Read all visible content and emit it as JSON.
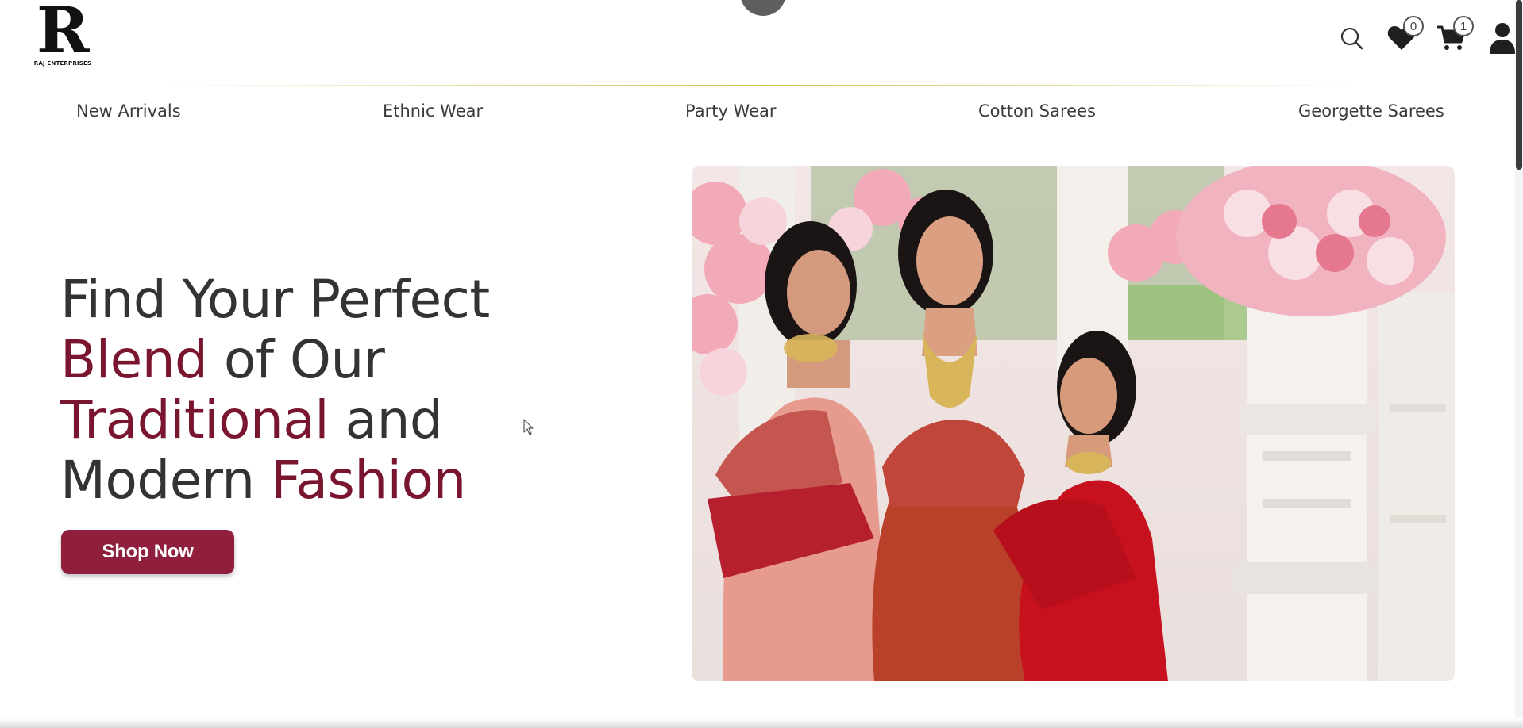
{
  "brand": {
    "logo_letter": "R",
    "logo_text": "RAJ ENTERPRISES"
  },
  "header": {
    "icons": {
      "search": "search-icon",
      "wishlist": "heart-icon",
      "cart": "cart-icon",
      "account": "user-icon"
    },
    "wishlist_count": "0",
    "cart_count": "1"
  },
  "nav": {
    "items": [
      {
        "label": "New Arrivals"
      },
      {
        "label": "Ethnic Wear"
      },
      {
        "label": "Party Wear"
      },
      {
        "label": "Cotton Sarees"
      },
      {
        "label": "Georgette Sarees"
      }
    ]
  },
  "hero": {
    "line1": "Find Your Perfect",
    "line2_accent": "Blend",
    "line2_rest": " of Our",
    "line3_accent": "Traditional",
    "line3_rest": " and",
    "line4_plain": "Modern ",
    "line4_accent": "Fashion",
    "cta_label": "Shop Now"
  },
  "colors": {
    "accent": "#7a1530",
    "button": "#8f1f3d",
    "text": "#333333",
    "divider": "#d2c050"
  }
}
